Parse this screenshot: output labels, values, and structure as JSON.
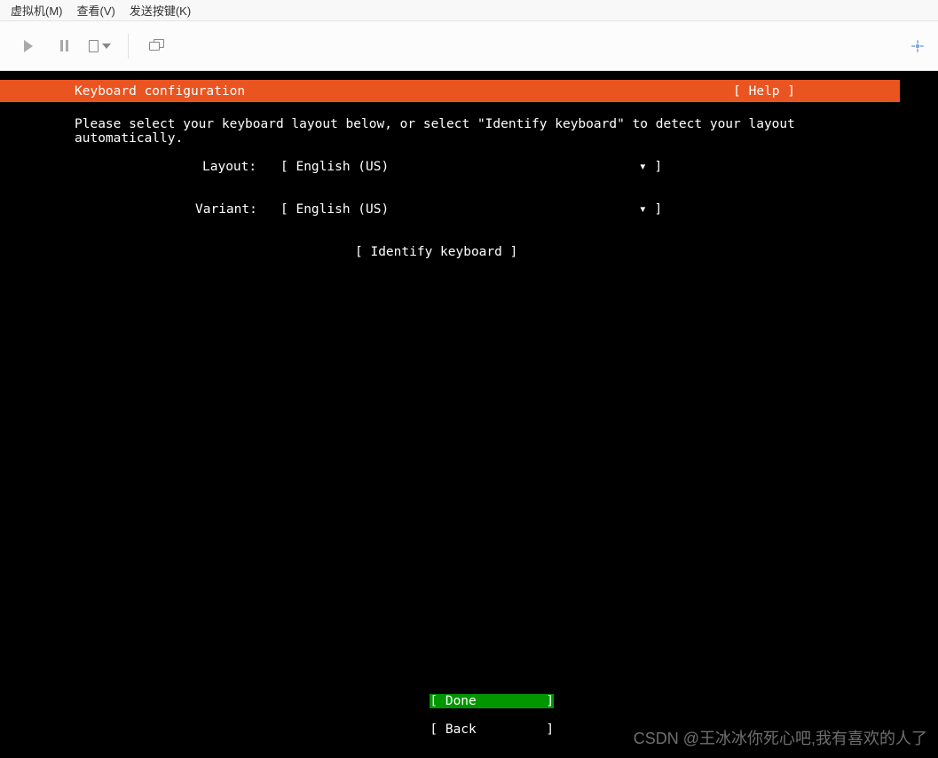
{
  "menubar": {
    "vm": "虚拟机(M)",
    "view": "查看(V)",
    "send": "发送按键(K)"
  },
  "toolbar": {
    "play_tip": "play",
    "pause_tip": "pause",
    "disk_tip": "disk",
    "screens_tip": "screens",
    "expand_tip": "expand"
  },
  "installer": {
    "title": "Keyboard configuration",
    "help": "[ Help ]",
    "instruction": "Please select your keyboard layout below, or select \"Identify keyboard\" to detect your layout\nautomatically.",
    "layout_label": "Layout:",
    "layout_select": "[ English (US)",
    "layout_drop": "▾ ]",
    "variant_label": "Variant:",
    "variant_select": "[ English (US)",
    "variant_drop": "▾ ]",
    "identify": "[ Identify keyboard ]",
    "done_btn": "[ Done         ]",
    "back_btn": "[ Back         ]"
  },
  "watermark": "CSDN @王冰冰你死心吧,我有喜欢的人了"
}
